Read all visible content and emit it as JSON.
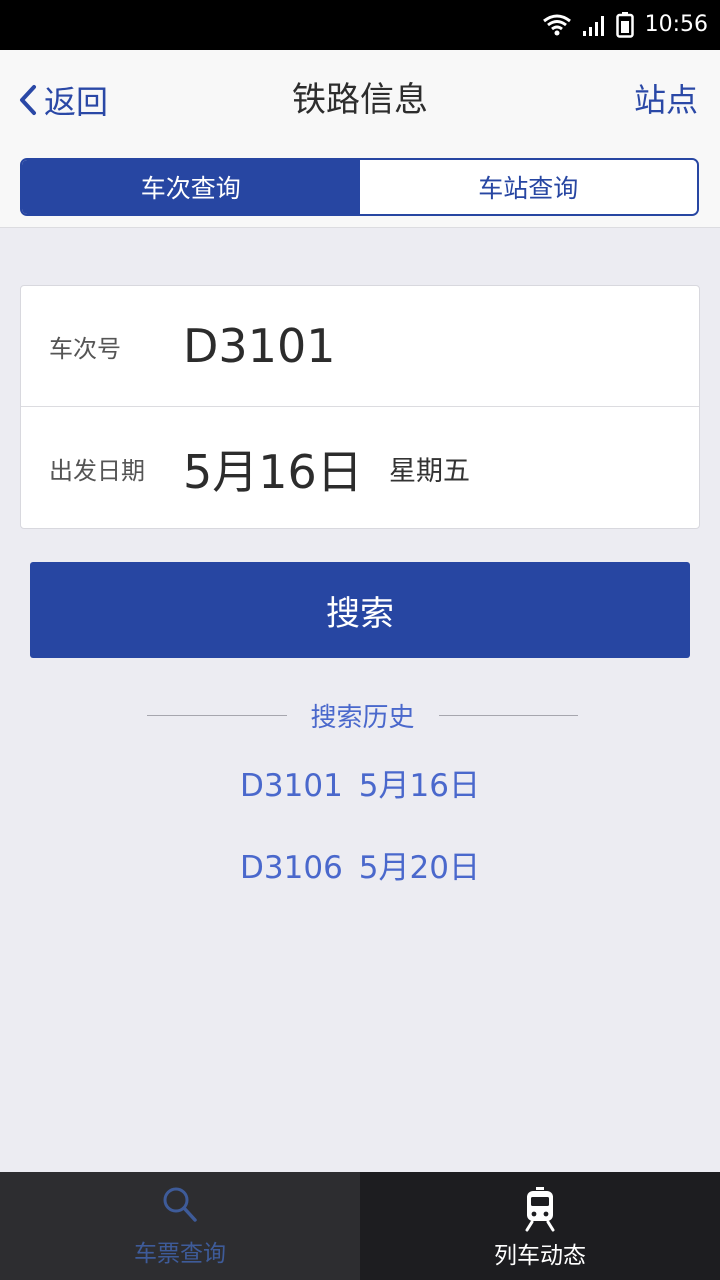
{
  "status_bar": {
    "time": "10:56"
  },
  "header": {
    "back_label": "返回",
    "title": "铁路信息",
    "station_label": "站点"
  },
  "segmented": {
    "tabs": [
      {
        "label": "车次查询",
        "active": true
      },
      {
        "label": "车站查询",
        "active": false
      }
    ]
  },
  "form": {
    "train_label": "车次号",
    "train_value": "D3101",
    "date_label": "出发日期",
    "date_value": "5月16日",
    "weekday": "星期五"
  },
  "search_button": "搜索",
  "history": {
    "title": "搜索历史",
    "items": [
      {
        "train": "D3101",
        "date": "5月16日"
      },
      {
        "train": "D3106",
        "date": "5月20日"
      }
    ]
  },
  "tabbar": {
    "tabs": [
      {
        "label": "车票查询",
        "icon": "search-icon",
        "active": false
      },
      {
        "label": "列车动态",
        "icon": "train-icon",
        "active": true
      }
    ]
  },
  "colors": {
    "accent": "#2746a2",
    "link": "#4a68cc",
    "background": "#ececf2"
  }
}
